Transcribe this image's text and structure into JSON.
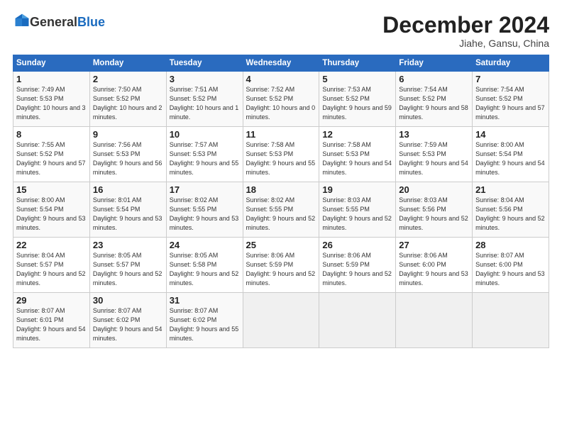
{
  "logo": {
    "general": "General",
    "blue": "Blue"
  },
  "title": "December 2024",
  "subtitle": "Jiahe, Gansu, China",
  "days_of_week": [
    "Sunday",
    "Monday",
    "Tuesday",
    "Wednesday",
    "Thursday",
    "Friday",
    "Saturday"
  ],
  "weeks": [
    [
      {
        "day": "1",
        "sunrise": "Sunrise: 7:49 AM",
        "sunset": "Sunset: 5:53 PM",
        "daylight": "Daylight: 10 hours and 3 minutes."
      },
      {
        "day": "2",
        "sunrise": "Sunrise: 7:50 AM",
        "sunset": "Sunset: 5:52 PM",
        "daylight": "Daylight: 10 hours and 2 minutes."
      },
      {
        "day": "3",
        "sunrise": "Sunrise: 7:51 AM",
        "sunset": "Sunset: 5:52 PM",
        "daylight": "Daylight: 10 hours and 1 minute."
      },
      {
        "day": "4",
        "sunrise": "Sunrise: 7:52 AM",
        "sunset": "Sunset: 5:52 PM",
        "daylight": "Daylight: 10 hours and 0 minutes."
      },
      {
        "day": "5",
        "sunrise": "Sunrise: 7:53 AM",
        "sunset": "Sunset: 5:52 PM",
        "daylight": "Daylight: 9 hours and 59 minutes."
      },
      {
        "day": "6",
        "sunrise": "Sunrise: 7:54 AM",
        "sunset": "Sunset: 5:52 PM",
        "daylight": "Daylight: 9 hours and 58 minutes."
      },
      {
        "day": "7",
        "sunrise": "Sunrise: 7:54 AM",
        "sunset": "Sunset: 5:52 PM",
        "daylight": "Daylight: 9 hours and 57 minutes."
      }
    ],
    [
      {
        "day": "8",
        "sunrise": "Sunrise: 7:55 AM",
        "sunset": "Sunset: 5:52 PM",
        "daylight": "Daylight: 9 hours and 57 minutes."
      },
      {
        "day": "9",
        "sunrise": "Sunrise: 7:56 AM",
        "sunset": "Sunset: 5:53 PM",
        "daylight": "Daylight: 9 hours and 56 minutes."
      },
      {
        "day": "10",
        "sunrise": "Sunrise: 7:57 AM",
        "sunset": "Sunset: 5:53 PM",
        "daylight": "Daylight: 9 hours and 55 minutes."
      },
      {
        "day": "11",
        "sunrise": "Sunrise: 7:58 AM",
        "sunset": "Sunset: 5:53 PM",
        "daylight": "Daylight: 9 hours and 55 minutes."
      },
      {
        "day": "12",
        "sunrise": "Sunrise: 7:58 AM",
        "sunset": "Sunset: 5:53 PM",
        "daylight": "Daylight: 9 hours and 54 minutes."
      },
      {
        "day": "13",
        "sunrise": "Sunrise: 7:59 AM",
        "sunset": "Sunset: 5:53 PM",
        "daylight": "Daylight: 9 hours and 54 minutes."
      },
      {
        "day": "14",
        "sunrise": "Sunrise: 8:00 AM",
        "sunset": "Sunset: 5:54 PM",
        "daylight": "Daylight: 9 hours and 54 minutes."
      }
    ],
    [
      {
        "day": "15",
        "sunrise": "Sunrise: 8:00 AM",
        "sunset": "Sunset: 5:54 PM",
        "daylight": "Daylight: 9 hours and 53 minutes."
      },
      {
        "day": "16",
        "sunrise": "Sunrise: 8:01 AM",
        "sunset": "Sunset: 5:54 PM",
        "daylight": "Daylight: 9 hours and 53 minutes."
      },
      {
        "day": "17",
        "sunrise": "Sunrise: 8:02 AM",
        "sunset": "Sunset: 5:55 PM",
        "daylight": "Daylight: 9 hours and 53 minutes."
      },
      {
        "day": "18",
        "sunrise": "Sunrise: 8:02 AM",
        "sunset": "Sunset: 5:55 PM",
        "daylight": "Daylight: 9 hours and 52 minutes."
      },
      {
        "day": "19",
        "sunrise": "Sunrise: 8:03 AM",
        "sunset": "Sunset: 5:55 PM",
        "daylight": "Daylight: 9 hours and 52 minutes."
      },
      {
        "day": "20",
        "sunrise": "Sunrise: 8:03 AM",
        "sunset": "Sunset: 5:56 PM",
        "daylight": "Daylight: 9 hours and 52 minutes."
      },
      {
        "day": "21",
        "sunrise": "Sunrise: 8:04 AM",
        "sunset": "Sunset: 5:56 PM",
        "daylight": "Daylight: 9 hours and 52 minutes."
      }
    ],
    [
      {
        "day": "22",
        "sunrise": "Sunrise: 8:04 AM",
        "sunset": "Sunset: 5:57 PM",
        "daylight": "Daylight: 9 hours and 52 minutes."
      },
      {
        "day": "23",
        "sunrise": "Sunrise: 8:05 AM",
        "sunset": "Sunset: 5:57 PM",
        "daylight": "Daylight: 9 hours and 52 minutes."
      },
      {
        "day": "24",
        "sunrise": "Sunrise: 8:05 AM",
        "sunset": "Sunset: 5:58 PM",
        "daylight": "Daylight: 9 hours and 52 minutes."
      },
      {
        "day": "25",
        "sunrise": "Sunrise: 8:06 AM",
        "sunset": "Sunset: 5:59 PM",
        "daylight": "Daylight: 9 hours and 52 minutes."
      },
      {
        "day": "26",
        "sunrise": "Sunrise: 8:06 AM",
        "sunset": "Sunset: 5:59 PM",
        "daylight": "Daylight: 9 hours and 52 minutes."
      },
      {
        "day": "27",
        "sunrise": "Sunrise: 8:06 AM",
        "sunset": "Sunset: 6:00 PM",
        "daylight": "Daylight: 9 hours and 53 minutes."
      },
      {
        "day": "28",
        "sunrise": "Sunrise: 8:07 AM",
        "sunset": "Sunset: 6:00 PM",
        "daylight": "Daylight: 9 hours and 53 minutes."
      }
    ],
    [
      {
        "day": "29",
        "sunrise": "Sunrise: 8:07 AM",
        "sunset": "Sunset: 6:01 PM",
        "daylight": "Daylight: 9 hours and 54 minutes."
      },
      {
        "day": "30",
        "sunrise": "Sunrise: 8:07 AM",
        "sunset": "Sunset: 6:02 PM",
        "daylight": "Daylight: 9 hours and 54 minutes."
      },
      {
        "day": "31",
        "sunrise": "Sunrise: 8:07 AM",
        "sunset": "Sunset: 6:02 PM",
        "daylight": "Daylight: 9 hours and 55 minutes."
      },
      null,
      null,
      null,
      null
    ]
  ]
}
